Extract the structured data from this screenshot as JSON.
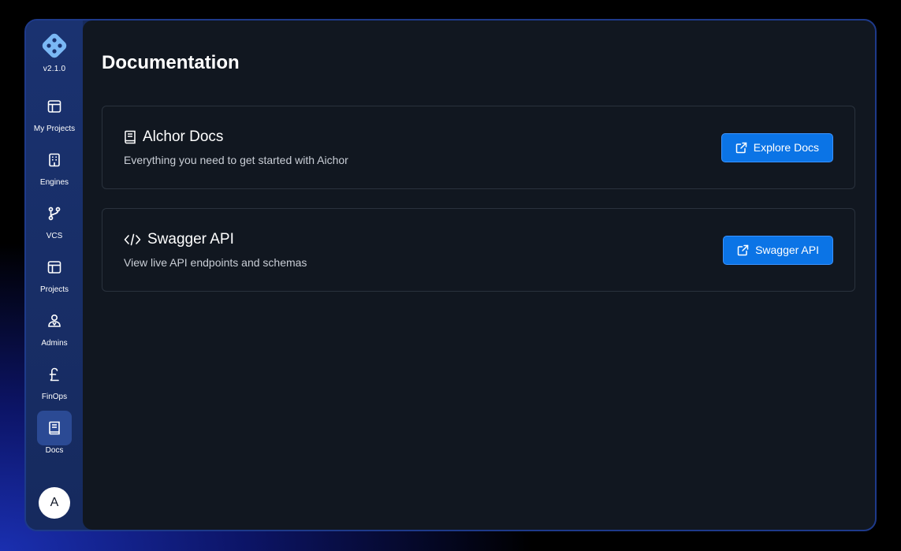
{
  "app": {
    "version": "v2.1.0",
    "avatar_initial": "A"
  },
  "sidebar": {
    "items": [
      {
        "label": "My Projects",
        "icon": "layout-icon",
        "active": false
      },
      {
        "label": "Engines",
        "icon": "building-icon",
        "active": false
      },
      {
        "label": "VCS",
        "icon": "git-branch-icon",
        "active": false
      },
      {
        "label": "Projects",
        "icon": "layout-icon",
        "active": false
      },
      {
        "label": "Admins",
        "icon": "user-admin-icon",
        "active": false
      },
      {
        "label": "FinOps",
        "icon": "pound-icon",
        "active": false
      },
      {
        "label": "Docs",
        "icon": "book-icon",
        "active": true
      }
    ]
  },
  "main": {
    "title": "Documentation",
    "cards": [
      {
        "icon": "book-icon",
        "title": "Alchor Docs",
        "description": "Everything you need to get started with Aichor",
        "button_label": "Explore Docs",
        "button_icon": "external-link-icon"
      },
      {
        "icon": "code-icon",
        "title": "Swagger API",
        "description": "View live API endpoints and schemas",
        "button_label": "Swagger API",
        "button_icon": "external-link-icon"
      }
    ]
  },
  "colors": {
    "accent": "#0b74e6",
    "sidebar_bg": "#1a3270",
    "main_bg": "#111720",
    "active_item_bg": "#2b4a94"
  }
}
